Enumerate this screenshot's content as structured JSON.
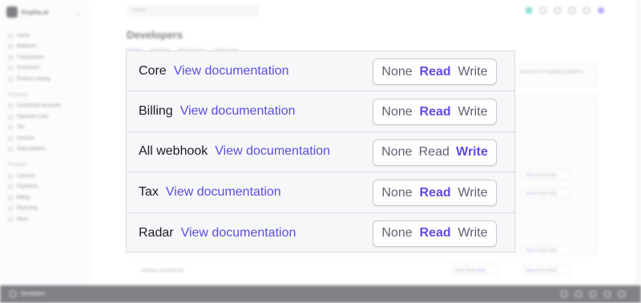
{
  "app": {
    "brand": "Kepha.ai",
    "search_placeholder": "Search",
    "page_title": "Developers",
    "subtabs": [
      "API keys",
      "Extensions",
      "SSO key forms",
      "Created views"
    ],
    "sidebar": {
      "main_items": [
        "Home",
        "Balances",
        "Transactions",
        "Customers",
        "Product catalog"
      ],
      "shortcuts_title": "Shortcuts",
      "shortcuts": [
        "Connected accounts",
        "Payment Links",
        "Tax",
        "Invoices",
        "Subscriptions"
      ],
      "products_title": "Products",
      "products": [
        "Connect",
        "Payments",
        "Billing",
        "Reporting",
        "More"
      ]
    },
    "bg_note": "based on the specific guidelines",
    "bg_last_row": "Charges and Refunds",
    "bottom_bar_label": "Developers"
  },
  "options": {
    "none": "None",
    "read": "Read",
    "write": "Write"
  },
  "link_text": "View documentation",
  "permissions": [
    {
      "name": "Core",
      "selected": "read"
    },
    {
      "name": "Billing",
      "selected": "read"
    },
    {
      "name": "All webhook",
      "selected": "write"
    },
    {
      "name": "Tax",
      "selected": "read"
    },
    {
      "name": "Radar",
      "selected": "read"
    }
  ],
  "colors": {
    "accent": "#5e4ce0",
    "text": "#1a1b25",
    "muted": "#5f6170",
    "panel_bg": "#f6f7f9"
  }
}
